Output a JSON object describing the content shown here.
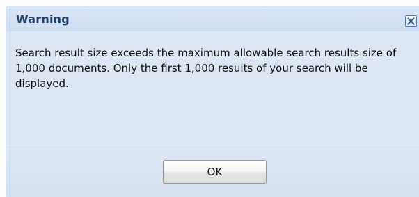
{
  "dialog": {
    "title": "Warning",
    "close_icon": "close-icon",
    "message": "Search result size exceeds the maximum allowable search results size of 1,000 documents. Only the first 1,000 results of your search will be displayed.",
    "ok_label": "OK"
  },
  "colors": {
    "title_text": "#1f3f6e",
    "dialog_background": "#dde7f4",
    "border": "#8ea6c6",
    "close_button_border": "#4f78b0"
  }
}
